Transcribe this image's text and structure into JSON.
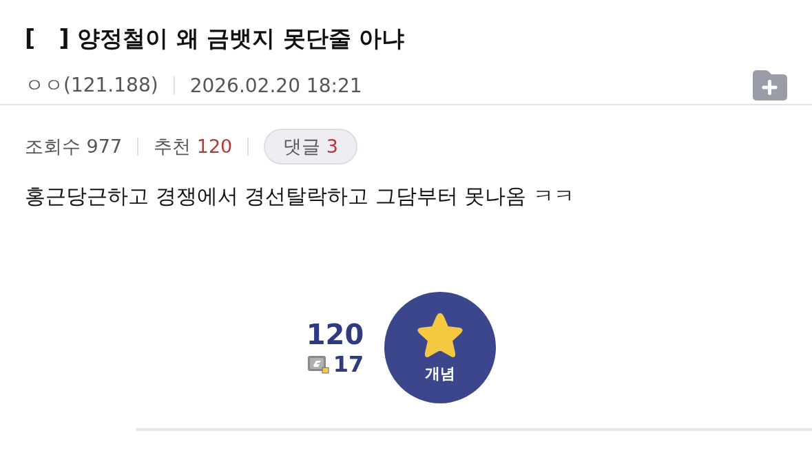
{
  "post": {
    "title": "[   ] 양정철이 왜 금뱃지 못단줄 아냐",
    "author": "ㅇㅇ(121.188)",
    "date": "2026.02.20 18:21"
  },
  "stats": {
    "views_label": "조회수",
    "views": "977",
    "recommend_label": "추천",
    "recommend": "120",
    "comments_label": "댓글",
    "comments": "3"
  },
  "body": "홍근당근하고 경쟁에서 경선탈락하고 그담부터 못나옴 ㅋㅋ",
  "recommend_box": {
    "count": "120",
    "fixed_count": "17",
    "button_label": "개념"
  }
}
